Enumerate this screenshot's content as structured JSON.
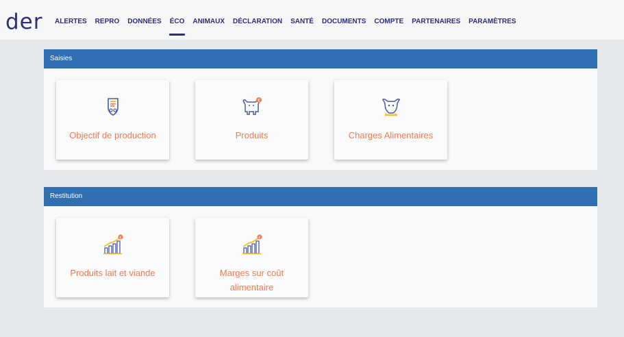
{
  "app": {
    "logo_text": "der"
  },
  "nav": {
    "items": [
      {
        "label": "ALERTES"
      },
      {
        "label": "REPRO"
      },
      {
        "label": "DONNÉES"
      },
      {
        "label": "ÉCO",
        "active": true
      },
      {
        "label": "ANIMAUX"
      },
      {
        "label": "DÉCLARATION"
      },
      {
        "label": "SANTÉ"
      },
      {
        "label": "DOCUMENTS"
      },
      {
        "label": "COMPTE"
      },
      {
        "label": "PARTENAIRES"
      },
      {
        "label": "PARAMÈTRES"
      }
    ]
  },
  "sections": [
    {
      "title": "Saisies",
      "cards": [
        {
          "label": "Objectif de production",
          "icon": "production-goal-icon"
        },
        {
          "label": "Produits",
          "icon": "cow-euro-icon"
        },
        {
          "label": "Charges Alimentaires",
          "icon": "cow-feed-icon"
        }
      ]
    },
    {
      "title": "Restitution",
      "cards": [
        {
          "label": "Produits lait et viande",
          "icon": "chart-euro-icon"
        },
        {
          "label": "Marges sur coût alimentaire",
          "icon": "chart-euro-icon"
        }
      ]
    }
  ],
  "colors": {
    "header_bar": "#2f6fb2",
    "nav_text": "#2b2d77",
    "card_label": "#ee7b53",
    "background": "#e6eaee"
  }
}
